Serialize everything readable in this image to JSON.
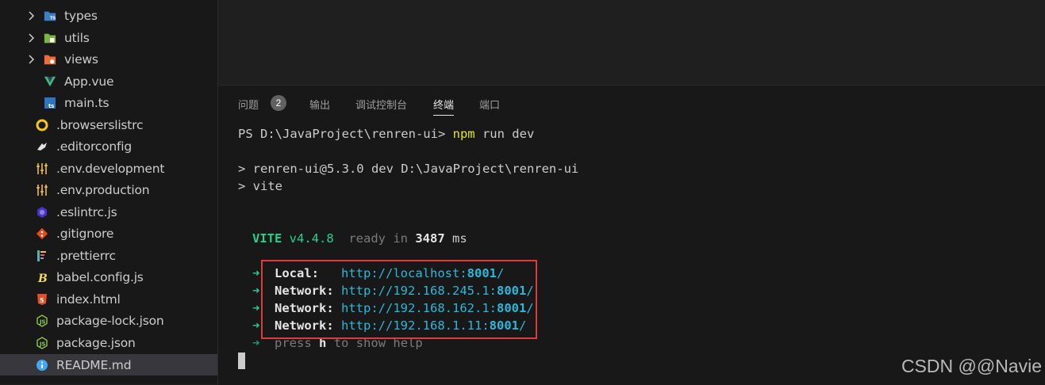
{
  "explorer": {
    "items": [
      {
        "label": "types",
        "icon": "ts-folder-icon"
      },
      {
        "label": "utils",
        "icon": "utils-folder-icon"
      },
      {
        "label": "views",
        "icon": "views-folder-icon"
      },
      {
        "label": "App.vue",
        "icon": "vue-file-icon"
      },
      {
        "label": "main.ts",
        "icon": "ts-file-icon"
      },
      {
        "label": ".browserslistrc",
        "icon": "browserslist-icon"
      },
      {
        "label": ".editorconfig",
        "icon": "editorconfig-icon"
      },
      {
        "label": ".env.development",
        "icon": "env-file-icon"
      },
      {
        "label": ".env.production",
        "icon": "env-file-icon"
      },
      {
        "label": ".eslintrc.js",
        "icon": "eslint-icon"
      },
      {
        "label": ".gitignore",
        "icon": "git-icon"
      },
      {
        "label": ".prettierrc",
        "icon": "prettier-icon"
      },
      {
        "label": "babel.config.js",
        "icon": "babel-icon"
      },
      {
        "label": "index.html",
        "icon": "html5-icon"
      },
      {
        "label": "package-lock.json",
        "icon": "nodejs-icon"
      },
      {
        "label": "package.json",
        "icon": "nodejs-icon"
      },
      {
        "label": "README.md",
        "icon": "info-icon"
      }
    ],
    "selected": "README.md"
  },
  "panel": {
    "tabs": [
      {
        "label": "问题",
        "badge": "2"
      },
      {
        "label": "输出"
      },
      {
        "label": "调试控制台"
      },
      {
        "label": "终端",
        "active": true
      },
      {
        "label": "端口"
      }
    ]
  },
  "terminal": {
    "prompt": "PS D:\\JavaProject\\renren-ui> ",
    "command": "npm run dev",
    "script_line": "> renren-ui@5.3.0 dev D:\\JavaProject\\renren-ui",
    "vite_line": "> vite",
    "vite_name": "VITE",
    "vite_version": "v4.4.8",
    "ready_text": "ready in",
    "ready_ms": "3487",
    "ready_unit": "ms",
    "arrow": "➜",
    "local_label": "Local:",
    "local_url_pre": "http://localhost:",
    "local_port": "8001",
    "network_label": "Network:",
    "networks": [
      {
        "pre": "http://192.168.245.1:",
        "port": "8001"
      },
      {
        "pre": "http://192.168.162.1:",
        "port": "8001"
      },
      {
        "pre": "http://192.168.1.11:",
        "port": "8001"
      }
    ],
    "help_pre": "press",
    "help_key": "h",
    "help_post": "to show help"
  },
  "watermark": "CSDN @@Navie",
  "colors": {
    "accent_highlight_box": "#e0393e",
    "terminal_green": "#23d18b",
    "terminal_cyan": "#29b8db",
    "terminal_yellow": "#e5e510"
  }
}
